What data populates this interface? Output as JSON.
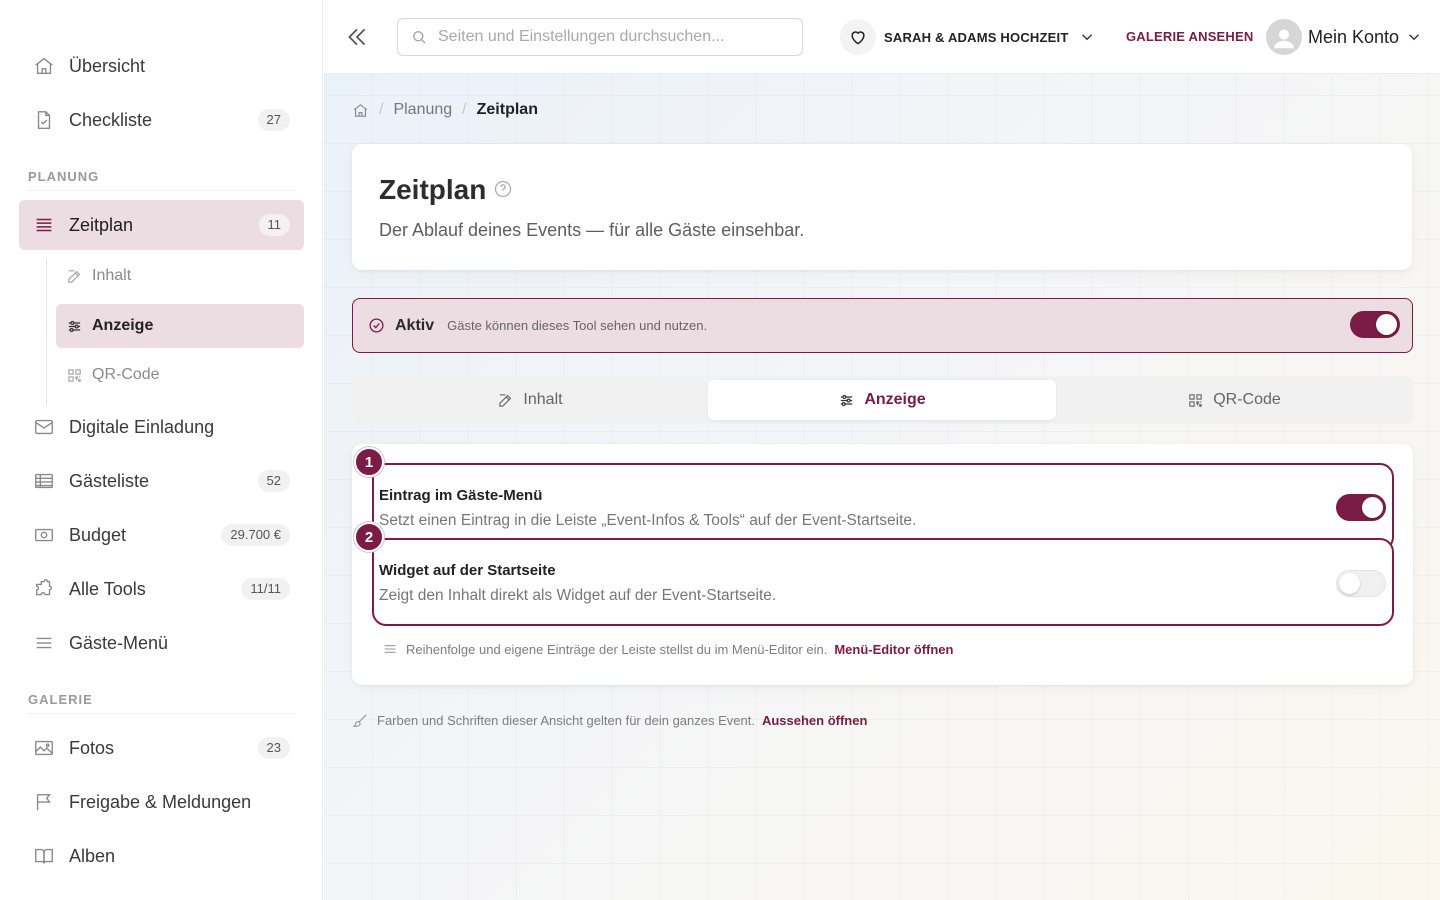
{
  "sidebar": {
    "items": [
      {
        "label": "Übersicht",
        "badge": ""
      },
      {
        "label": "Checkliste",
        "badge": "27"
      },
      {
        "label": "Zeitplan",
        "badge": "11"
      },
      {
        "label": "Digitale Einladung",
        "badge": ""
      },
      {
        "label": "Gästeliste",
        "badge": "52"
      },
      {
        "label": "Budget",
        "badge": "29.700 €"
      },
      {
        "label": "Alle Tools",
        "badge": "11/11"
      },
      {
        "label": "Gäste-Menü",
        "badge": ""
      },
      {
        "label": "Fotos",
        "badge": "23"
      },
      {
        "label": "Freigabe & Meldungen",
        "badge": ""
      },
      {
        "label": "Alben",
        "badge": ""
      }
    ],
    "sections": {
      "planung": "PLANUNG",
      "galerie": "GALERIE"
    },
    "sub_items": [
      {
        "label": "Inhalt"
      },
      {
        "label": "Anzeige"
      },
      {
        "label": "QR-Code"
      }
    ]
  },
  "topbar": {
    "search_placeholder": "Seiten und Einstellungen durchsuchen...",
    "event_name": "SARAH & ADAMS HOCHZEIT",
    "gallery_link": "GALERIE ANSEHEN",
    "account_label": "Mein Konto"
  },
  "breadcrumb": {
    "parent": "Planung",
    "current": "Zeitplan"
  },
  "page": {
    "title": "Zeitplan",
    "subtitle": "Der Ablauf deines Events — für alle Gäste einsehbar."
  },
  "status": {
    "state": "Aktiv",
    "description": "Gäste können dieses Tool sehen und nutzen.",
    "enabled": true
  },
  "tabs": [
    {
      "label": "Inhalt"
    },
    {
      "label": "Anzeige"
    },
    {
      "label": "QR-Code"
    }
  ],
  "settings": [
    {
      "marker": "1",
      "title": "Eintrag im Gäste-Menü",
      "description": "Setzt einen Eintrag in die Leiste „Event-Infos & Tools“ auf der Event-Startseite.",
      "enabled": true
    },
    {
      "marker": "2",
      "title": "Widget auf der Startseite",
      "description": "Zeigt den Inhalt direkt als Widget auf der Event-Startseite.",
      "enabled": false
    }
  ],
  "menu_hint": {
    "text": "Reihenfolge und eigene Einträge der Leiste stellst du im Menü-Editor ein.",
    "link": "Menü-Editor öffnen"
  },
  "footer_hint": {
    "text": "Farben und Schriften dieser Ansicht gelten für dein ganzes Event.",
    "link": "Aussehen öffnen"
  },
  "colors": {
    "accent": "#7a1c45",
    "accent_soft": "#ecdde2"
  }
}
